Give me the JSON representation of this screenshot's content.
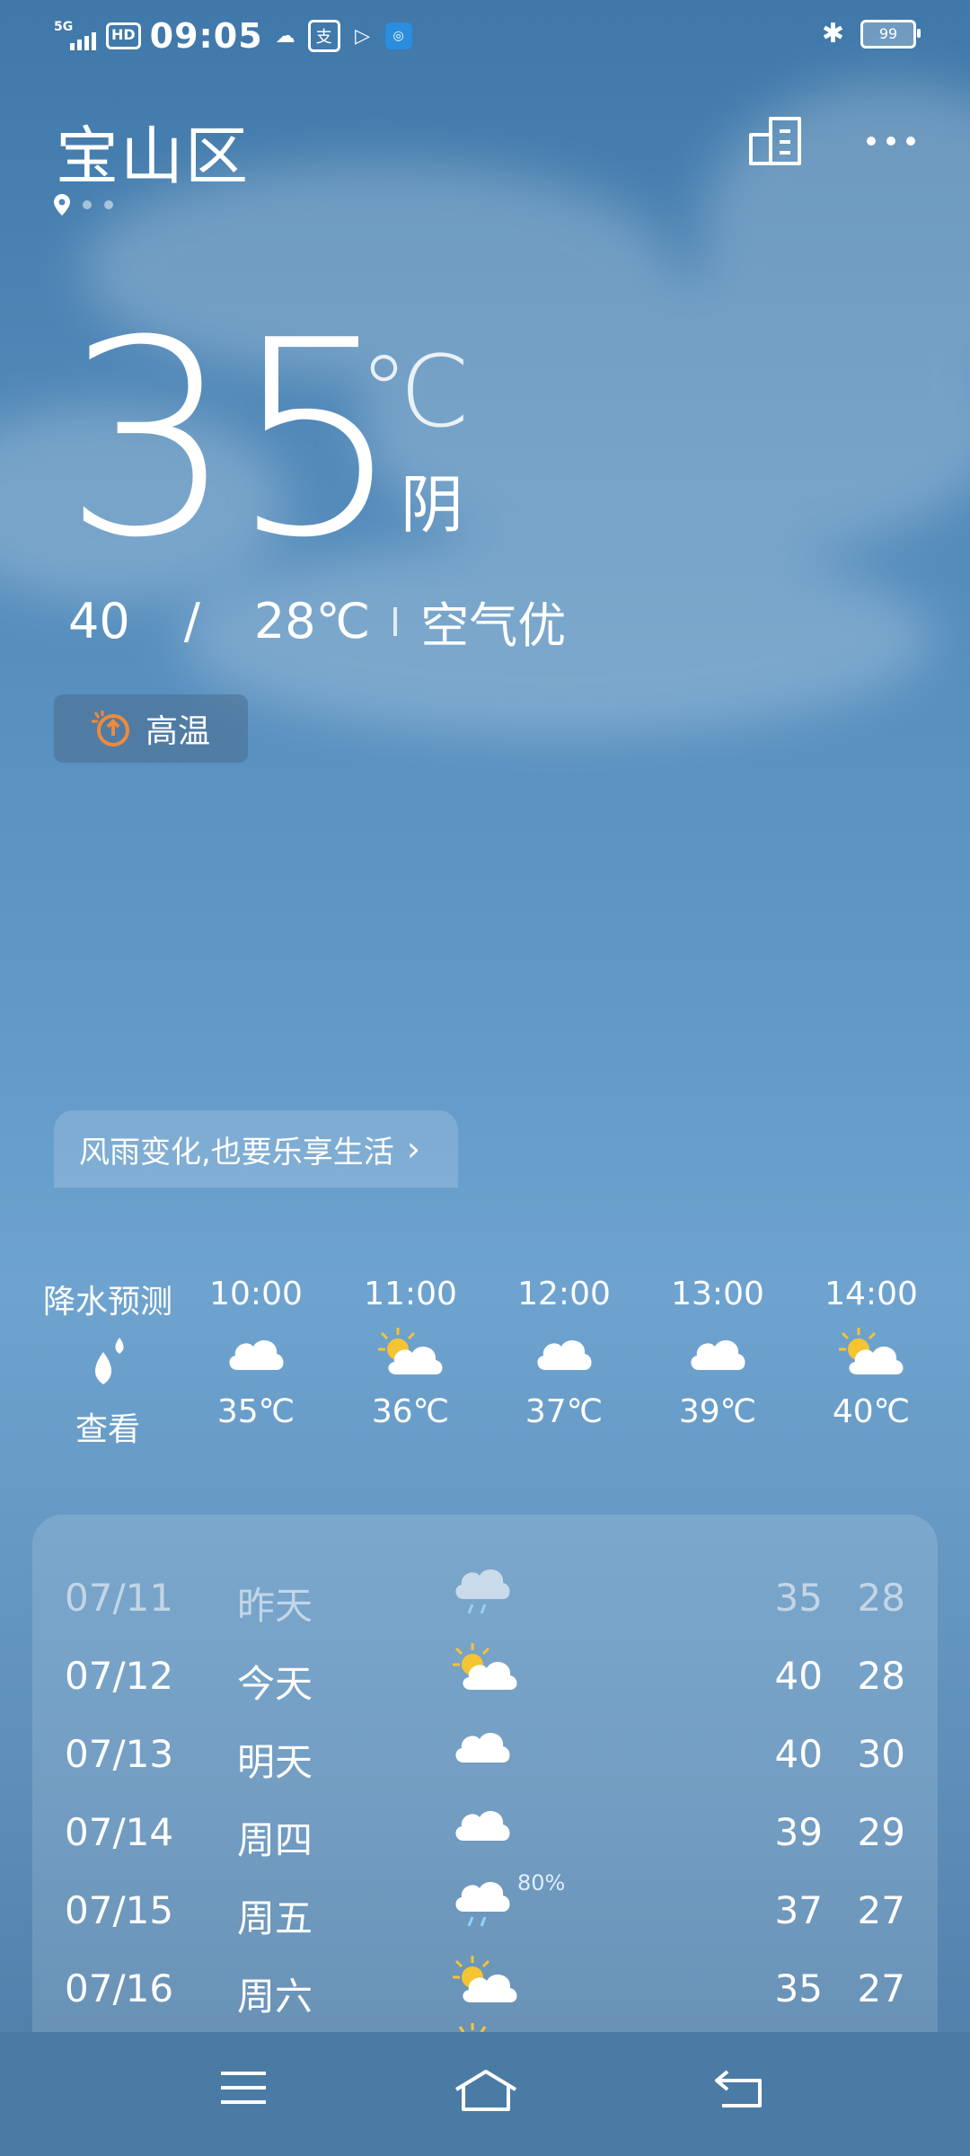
{
  "status": {
    "time": "09:05",
    "network": "5G",
    "hd": "HD",
    "battery": "99"
  },
  "header": {
    "city": "宝山区"
  },
  "current": {
    "temp": "35",
    "unit": "℃",
    "condition": "阴",
    "high": "40",
    "separator": "/",
    "low": "28℃",
    "air": "空气优",
    "alert": "高温"
  },
  "banner": {
    "text": "风雨变化,也要乐享生活",
    "chevron": "›"
  },
  "hourly": [
    {
      "time": "降水预测",
      "icon": "raindrop-icon",
      "value": "查看"
    },
    {
      "time": "10:00",
      "icon": "cloud-icon",
      "value": "35℃"
    },
    {
      "time": "11:00",
      "icon": "partly-cloudy-icon",
      "value": "36℃"
    },
    {
      "time": "12:00",
      "icon": "cloud-icon",
      "value": "37℃"
    },
    {
      "time": "13:00",
      "icon": "cloud-icon",
      "value": "39℃"
    },
    {
      "time": "14:00",
      "icon": "partly-cloudy-icon",
      "value": "40℃"
    }
  ],
  "daily": [
    {
      "date": "07/11",
      "day": "昨天",
      "icon": "rain-cloud-icon",
      "high": "35",
      "low": "28"
    },
    {
      "date": "07/12",
      "day": "今天",
      "icon": "partly-cloudy-icon",
      "high": "40",
      "low": "28"
    },
    {
      "date": "07/13",
      "day": "明天",
      "icon": "cloud-icon",
      "high": "40",
      "low": "30"
    },
    {
      "date": "07/14",
      "day": "周四",
      "icon": "cloud-icon",
      "high": "39",
      "low": "29"
    },
    {
      "date": "07/15",
      "day": "周五",
      "icon": "rain-cloud-icon",
      "precip": "80%",
      "high": "37",
      "low": "27"
    },
    {
      "date": "07/16",
      "day": "周六",
      "icon": "partly-cloudy-icon",
      "high": "35",
      "low": "27"
    }
  ]
}
